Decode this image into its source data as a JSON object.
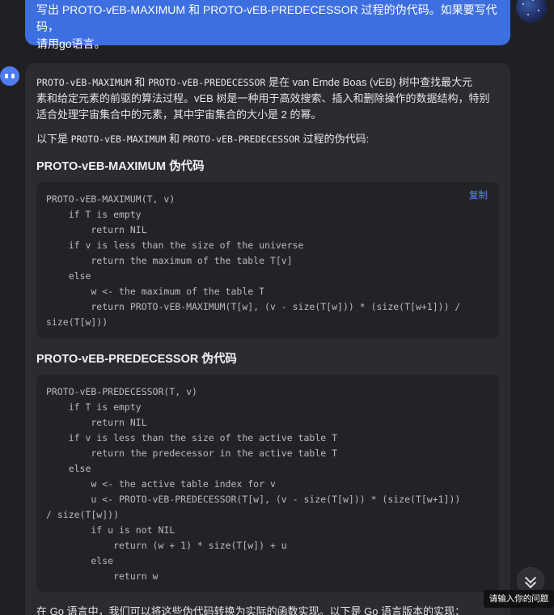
{
  "user_message": {
    "text_line1": "写出 PROTO-vEB-MAXIMUM 和 PROTO-vEB-PREDECESSOR 过程的伪代码。如果要写代码，",
    "text_line2": "请用go语言。"
  },
  "bot_message": {
    "intro_prefix_mono_1": "PROTO-vEB-MAXIMUM",
    "intro_and": " 和 ",
    "intro_prefix_mono_2": "PROTO-vEB-PREDECESSOR",
    "intro_rest_line1": " 是在 van Emde Boas (vEB) 树中查找最大元",
    "intro_line2": "素和给定元素的前驱的算法过程。vEB 树是一种用于高效搜索、插入和删除操作的数据结构，特别",
    "intro_line3": "适合处理宇宙集合中的元素，其中宇宙集合的大小是 2 的幂。",
    "lead_prefix": "以下是 ",
    "lead_mono_1": "PROTO-vEB-MAXIMUM",
    "lead_and": " 和 ",
    "lead_mono_2": "PROTO-vEB-PREDECESSOR",
    "lead_suffix": " 过程的伪代码:",
    "section1_heading": "PROTO-vEB-MAXIMUM 伪代码",
    "copy_label": "复制",
    "code1": [
      "PROTO-vEB-MAXIMUM(T, v)",
      "    if T is empty",
      "        return NIL",
      "    if v is less than the size of the universe",
      "        return the maximum of the table T[v]",
      "    else",
      "        w <- the maximum of the table T",
      "        return PROTO-vEB-MAXIMUM(T[w], (v - size(T[w])) * (size(T[w+1])) /",
      "size(T[w]))"
    ],
    "section2_heading": "PROTO-vEB-PREDECESSOR 伪代码",
    "code2": [
      "PROTO-vEB-PREDECESSOR(T, v)",
      "    if T is empty",
      "        return NIL",
      "    if v is less than the size of the active table T",
      "        return the predecessor in the active table T",
      "    else",
      "        w <- the active table index for v",
      "        u <- PROTO-vEB-PREDECESSOR(T[w], (v - size(T[w])) * (size(T[w+1]))",
      "/ size(T[w]))",
      "        if u is not NIL",
      "            return (w + 1) * size(T[w]) + u",
      "        else",
      "            return w"
    ],
    "outro": "在 Go 语言中，我们可以将这些伪代码转换为实际的函数实现。以下是 Go 语言版本的实现："
  },
  "tooltip": "请输入你的问题",
  "icons": {
    "scroll_down": "double-chevron-down-icon",
    "bot_avatar": "bot-avatar-icon",
    "user_avatar": "user-avatar-icon"
  },
  "colors": {
    "accent": "#3d6fe0",
    "link": "#5b8cf5",
    "card_bg": "#2b2b30",
    "code_bg": "#232327"
  }
}
